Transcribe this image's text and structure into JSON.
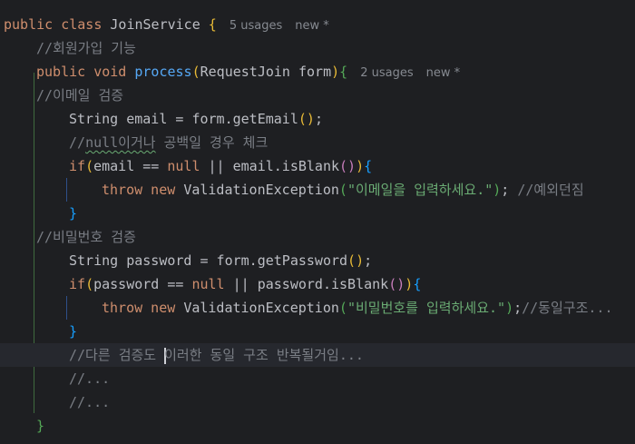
{
  "editor": {
    "lines": [
      {
        "indent": 0,
        "tokens": [
          [
            "kw",
            "public class "
          ],
          [
            "",
            "JoinService "
          ],
          [
            "by",
            "{"
          ]
        ],
        "hint": [
          "5 usages",
          "new *"
        ]
      },
      {
        "indent": 1,
        "tokens": [
          [
            "cm",
            "//회원가입 기능"
          ]
        ]
      },
      {
        "indent": 1,
        "tokens": [
          [
            "kw",
            "public void "
          ],
          [
            "fn",
            "process"
          ],
          [
            "by",
            "("
          ],
          [
            "",
            "RequestJoin form"
          ],
          [
            "by",
            ")"
          ],
          [
            "bg",
            "{"
          ]
        ],
        "hint": [
          "2 usages",
          "new *"
        ]
      },
      {
        "indent": 1,
        "tokens": [
          [
            "cm",
            "//이메일 검증"
          ]
        ]
      },
      {
        "indent": 2,
        "tokens": [
          [
            "",
            "String email = form.getEmail"
          ],
          [
            "by",
            "()"
          ],
          [
            "",
            ";"
          ]
        ]
      },
      {
        "indent": 2,
        "tokens": [
          [
            "cm",
            "//"
          ],
          [
            "cm squig",
            "null이거나"
          ],
          [
            "cm",
            " 공백일 경우 체크"
          ]
        ]
      },
      {
        "indent": 2,
        "tokens": [
          [
            "kw",
            "if"
          ],
          [
            "by",
            "("
          ],
          [
            "",
            "email == "
          ],
          [
            "kw",
            "null"
          ],
          [
            "",
            " || email.isBlank"
          ],
          [
            "bp",
            "()"
          ],
          [
            "by",
            ")"
          ],
          [
            "bb",
            "{"
          ]
        ]
      },
      {
        "indent": 3,
        "tokens": [
          [
            "kw",
            "throw new "
          ],
          [
            "",
            "ValidationException"
          ],
          [
            "bg",
            "("
          ],
          [
            "str",
            "\"이메일을 입력하세요.\""
          ],
          [
            "bg",
            ")"
          ],
          [
            "",
            "; "
          ],
          [
            "cm",
            "//예외던짐"
          ]
        ]
      },
      {
        "indent": 2,
        "tokens": [
          [
            "bb",
            "}"
          ]
        ]
      },
      {
        "indent": 1,
        "tokens": [
          [
            "cm",
            "//비밀번호 검증"
          ]
        ]
      },
      {
        "indent": 2,
        "tokens": [
          [
            "",
            "String password = form.getPassword"
          ],
          [
            "by",
            "()"
          ],
          [
            "",
            ";"
          ]
        ]
      },
      {
        "indent": 2,
        "tokens": [
          [
            "kw",
            "if"
          ],
          [
            "by",
            "("
          ],
          [
            "",
            "password == "
          ],
          [
            "kw",
            "null"
          ],
          [
            "",
            " || password.isBlank"
          ],
          [
            "bp",
            "()"
          ],
          [
            "by",
            ")"
          ],
          [
            "bb",
            "{"
          ]
        ]
      },
      {
        "indent": 3,
        "tokens": [
          [
            "kw",
            "throw new "
          ],
          [
            "",
            "ValidationException"
          ],
          [
            "bg",
            "("
          ],
          [
            "str",
            "\"비밀번호를 입력하세요.\""
          ],
          [
            "bg",
            ")"
          ],
          [
            "",
            ";"
          ],
          [
            "cm",
            "//동일구조..."
          ]
        ]
      },
      {
        "indent": 2,
        "tokens": [
          [
            "bb",
            "}"
          ]
        ]
      },
      {
        "indent": 2,
        "current": true,
        "tokens": [
          [
            "cm",
            "//다른 검증도 "
          ],
          [
            "caret",
            ""
          ],
          [
            "cm",
            "이러한 동일 구조 반복될거임..."
          ]
        ]
      },
      {
        "indent": 2,
        "tokens": [
          [
            "cm",
            "//..."
          ]
        ]
      },
      {
        "indent": 2,
        "tokens": [
          [
            "cm",
            "//..."
          ]
        ]
      },
      {
        "indent": 1,
        "tokens": [
          [
            "bg",
            "}"
          ]
        ]
      }
    ]
  }
}
